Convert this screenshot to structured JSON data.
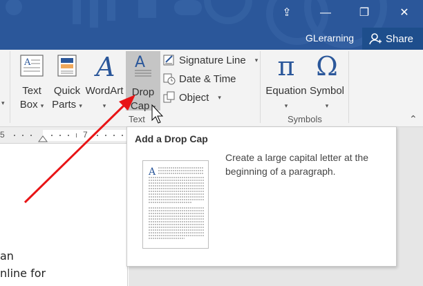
{
  "window": {
    "user_name": "GLerarning",
    "share_label": "Share",
    "controls": {
      "display": "⇪",
      "minimize": "—",
      "restore": "❐",
      "close": "✕"
    }
  },
  "ribbon": {
    "text_group": {
      "label": "Text",
      "text_box": {
        "line1": "Text",
        "line2": "Box",
        "icon": "text-box-icon"
      },
      "quick_parts": {
        "line1": "Quick",
        "line2": "Parts",
        "icon": "quick-parts-icon"
      },
      "wordart": {
        "line1": "WordArt",
        "icon": "wordart-icon"
      },
      "drop_cap": {
        "line1": "Drop",
        "line2": "Cap",
        "icon": "drop-cap-icon"
      },
      "signature_line": {
        "label": "Signature Line",
        "icon": "signature-line-icon"
      },
      "date_time": {
        "label": "Date & Time",
        "icon": "date-time-icon"
      },
      "object": {
        "label": "Object",
        "icon": "object-icon"
      }
    },
    "symbols_group": {
      "label": "Symbols",
      "equation": {
        "label": "Equation",
        "glyph": "π"
      },
      "symbol": {
        "label": "Symbol",
        "glyph": "Ω"
      }
    },
    "collapse_glyph": "⌃"
  },
  "ruler": {
    "left_number": "5",
    "marker_number": "7"
  },
  "document": {
    "lines": [
      "an",
      "nline for"
    ]
  },
  "tooltip": {
    "title": "Add a Drop Cap",
    "description": "Create a large capital letter at the beginning of a paragraph.",
    "preview_letter": "A"
  },
  "colors": {
    "title_bar": "#2b579a",
    "ribbon_bg": "#f3f3f3",
    "selected_button": "#c5c5c5",
    "icon_blue": "#2b579a",
    "annotation_arrow": "#e81416"
  }
}
